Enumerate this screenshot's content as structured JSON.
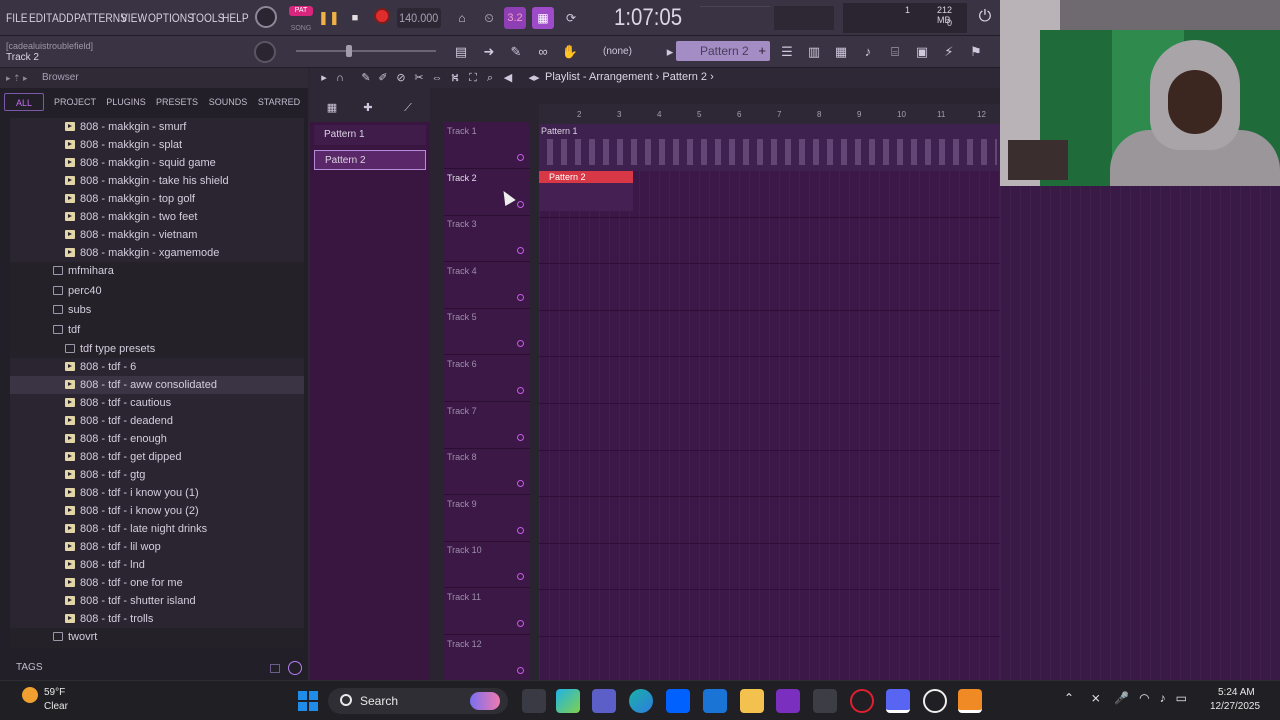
{
  "menu": {
    "file": "FILE",
    "edit": "EDIT",
    "add": "ADD",
    "patterns": "PATTERNS",
    "view": "VIEW",
    "options": "OPTIONS",
    "tools": "TOOLS",
    "help": "HELP"
  },
  "transport": {
    "pat_label": "PAT",
    "song_label": "SONG",
    "tempo": "140.000",
    "step_label": "3.2",
    "time": "1:07:05"
  },
  "monitor": {
    "memory": "212 MB",
    "polyphony": "1",
    "cpu": "0"
  },
  "hint": {
    "project": "[cadealuistroublefield]",
    "current": "Track 2"
  },
  "toolbar2": {
    "snap": "(none)",
    "pattern": "Pattern 2",
    "pattern_add": "+"
  },
  "browser": {
    "title": "Browser",
    "tabs": {
      "all": "ALL",
      "project": "PROJECT",
      "plugins": "PLUGINS",
      "presets": "PRESETS",
      "sounds": "SOUNDS",
      "starred": "STARRED"
    },
    "items": [
      {
        "label": "808 - makkgin - smurf",
        "kind": "preset"
      },
      {
        "label": "808 - makkgin - splat",
        "kind": "preset"
      },
      {
        "label": "808 - makkgin - squid game",
        "kind": "preset"
      },
      {
        "label": "808 - makkgin - take his shield",
        "kind": "preset"
      },
      {
        "label": "808 - makkgin - top golf",
        "kind": "preset"
      },
      {
        "label": "808 - makkgin - two feet",
        "kind": "preset"
      },
      {
        "label": "808 - makkgin - vietnam",
        "kind": "preset"
      },
      {
        "label": "808 - makkgin - xgamemode",
        "kind": "preset"
      },
      {
        "label": "mfmihara",
        "kind": "folder"
      },
      {
        "label": "perc40",
        "kind": "folder"
      },
      {
        "label": "subs",
        "kind": "folder"
      },
      {
        "label": "tdf",
        "kind": "folder"
      },
      {
        "label": "tdf type presets",
        "kind": "subfolder"
      },
      {
        "label": "808 - tdf - 6",
        "kind": "preset"
      },
      {
        "label": "808 - tdf - aww consolidated",
        "kind": "preset",
        "highlight": true
      },
      {
        "label": "808 - tdf - cautious",
        "kind": "preset"
      },
      {
        "label": "808 - tdf - deadend",
        "kind": "preset"
      },
      {
        "label": "808 - tdf - enough",
        "kind": "preset"
      },
      {
        "label": "808 - tdf - get dipped",
        "kind": "preset"
      },
      {
        "label": "808 - tdf - gtg",
        "kind": "preset"
      },
      {
        "label": "808 - tdf - i know you (1)",
        "kind": "preset"
      },
      {
        "label": "808 - tdf - i know you (2)",
        "kind": "preset"
      },
      {
        "label": "808 - tdf - late night drinks",
        "kind": "preset"
      },
      {
        "label": "808 - tdf - lil wop",
        "kind": "preset"
      },
      {
        "label": "808 - tdf - lnd",
        "kind": "preset"
      },
      {
        "label": "808 - tdf - one for me",
        "kind": "preset"
      },
      {
        "label": "808 - tdf - shutter island",
        "kind": "preset"
      },
      {
        "label": "808 - tdf - trolls",
        "kind": "preset"
      },
      {
        "label": "twovrt",
        "kind": "folder"
      }
    ],
    "tags_label": "TAGS"
  },
  "playlist": {
    "title": "Playlist - Arrangement",
    "current_pattern": "Pattern 2",
    "patterns": [
      "Pattern 1",
      "Pattern 2"
    ],
    "selected_pattern": "Pattern 2",
    "ruler": [
      "2",
      "3",
      "4",
      "5",
      "6",
      "7",
      "8",
      "9",
      "10",
      "11",
      "12"
    ],
    "tracks": [
      "Track 1",
      "Track 2",
      "Track 3",
      "Track 4",
      "Track 5",
      "Track 6",
      "Track 7",
      "Track 8",
      "Track 9",
      "Track 10",
      "Track 11",
      "Track 12"
    ],
    "clips": [
      {
        "label": "Pattern 1",
        "track": 1
      },
      {
        "label": "Pattern 2",
        "track": 2
      }
    ]
  },
  "taskbar": {
    "weather_temp": "59°F",
    "weather_desc": "Clear",
    "search_label": "Search",
    "time": "5:24 AM",
    "date": "12/27/2025"
  },
  "colors": {
    "accent": "#c46cf7",
    "playlist_bg": "#3b1848",
    "clip_red": "#d83746"
  }
}
